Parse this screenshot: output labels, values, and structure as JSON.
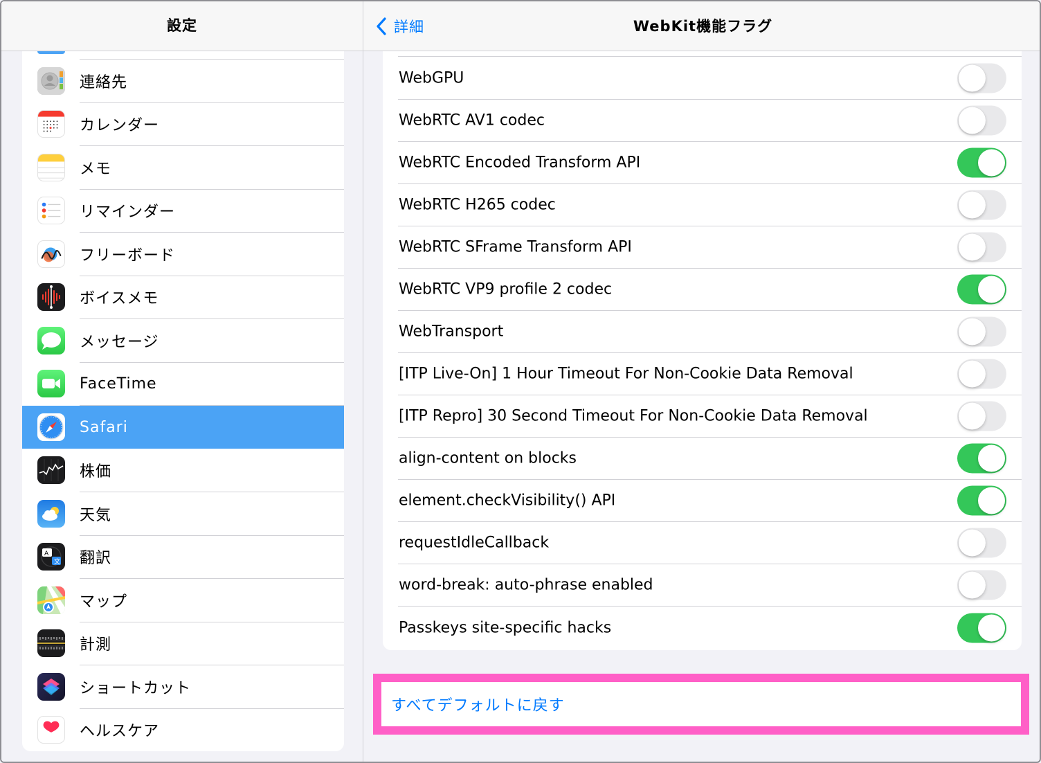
{
  "left": {
    "title": "設定",
    "items": [
      {
        "label": "連絡先",
        "icon": "contacts-icon"
      },
      {
        "label": "カレンダー",
        "icon": "calendar-icon"
      },
      {
        "label": "メモ",
        "icon": "notes-icon"
      },
      {
        "label": "リマインダー",
        "icon": "reminders-icon"
      },
      {
        "label": "フリーボード",
        "icon": "freeform-icon"
      },
      {
        "label": "ボイスメモ",
        "icon": "voice-memos-icon"
      },
      {
        "label": "メッセージ",
        "icon": "messages-icon"
      },
      {
        "label": "FaceTime",
        "icon": "facetime-icon"
      },
      {
        "label": "Safari",
        "icon": "safari-icon",
        "selected": true
      },
      {
        "label": "株価",
        "icon": "stocks-icon"
      },
      {
        "label": "天気",
        "icon": "weather-icon"
      },
      {
        "label": "翻訳",
        "icon": "translate-icon"
      },
      {
        "label": "マップ",
        "icon": "maps-icon"
      },
      {
        "label": "計測",
        "icon": "measure-icon"
      },
      {
        "label": "ショートカット",
        "icon": "shortcuts-icon"
      },
      {
        "label": "ヘルスケア",
        "icon": "health-icon"
      }
    ]
  },
  "right": {
    "back_label": "詳細",
    "title": "WebKit機能フラグ",
    "flags": [
      {
        "label": "WebGPU",
        "on": false
      },
      {
        "label": "WebRTC AV1 codec",
        "on": false
      },
      {
        "label": "WebRTC Encoded Transform API",
        "on": true
      },
      {
        "label": "WebRTC H265 codec",
        "on": false
      },
      {
        "label": "WebRTC SFrame Transform API",
        "on": false
      },
      {
        "label": "WebRTC VP9 profile 2 codec",
        "on": true
      },
      {
        "label": "WebTransport",
        "on": false
      },
      {
        "label": "[ITP Live-On] 1 Hour Timeout For Non-Cookie Data Removal",
        "on": false
      },
      {
        "label": "[ITP Repro] 30 Second Timeout For Non-Cookie Data Removal",
        "on": false
      },
      {
        "label": "align-content on blocks",
        "on": true
      },
      {
        "label": "element.checkVisibility() API",
        "on": true
      },
      {
        "label": "requestIdleCallback",
        "on": false
      },
      {
        "label": "word-break: auto-phrase enabled",
        "on": false
      },
      {
        "label": "Passkeys site-specific hacks",
        "on": true
      }
    ],
    "reset_label": "すべてデフォルトに戻す"
  },
  "colors": {
    "accent": "#007aff",
    "selected": "#4ba3f5",
    "toggle_on": "#34c759",
    "toggle_off": "#e9e9eb",
    "highlight_frame": "#ff5fc7"
  }
}
